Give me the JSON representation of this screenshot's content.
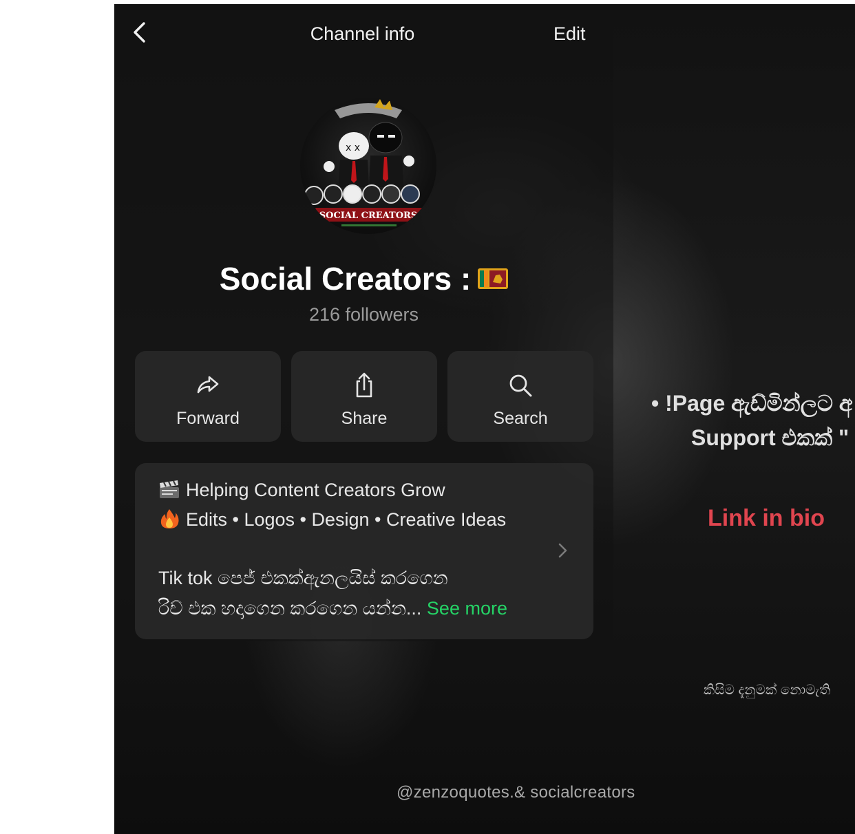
{
  "header": {
    "title": "Channel info",
    "edit_label": "Edit"
  },
  "channel": {
    "name": "Social Creators :",
    "followers": "216 followers",
    "avatar_text": "SOCIAL CREATORS"
  },
  "actions": [
    {
      "label": "Forward",
      "icon": "forward-icon"
    },
    {
      "label": "Share",
      "icon": "share-icon"
    },
    {
      "label": "Search",
      "icon": "search-icon"
    }
  ],
  "description": {
    "line1": "Helping Content Creators Grow",
    "line2": "Edits • Logos • Design • Creative Ideas",
    "line3": "Tik tok පෙජ් එකක්ඇනලයිස් කරගෙන",
    "line4": "රිච් එක හදාගෙන කරගෙන යන්න...",
    "see_more": "See more"
  },
  "background_text": {
    "bullet_line": "• !Page ඇඩ්මින්ලට අ",
    "support_line": "Support එකක් \"",
    "link_in_bio": "Link in bio",
    "small_line": "කිසිම දැනුමක් නොමැති",
    "watermark": "@zenzoquotes.& socialcreators"
  },
  "colors": {
    "accent_green": "#25d366",
    "link_red": "#e0454f",
    "card_bg": "#282828"
  }
}
